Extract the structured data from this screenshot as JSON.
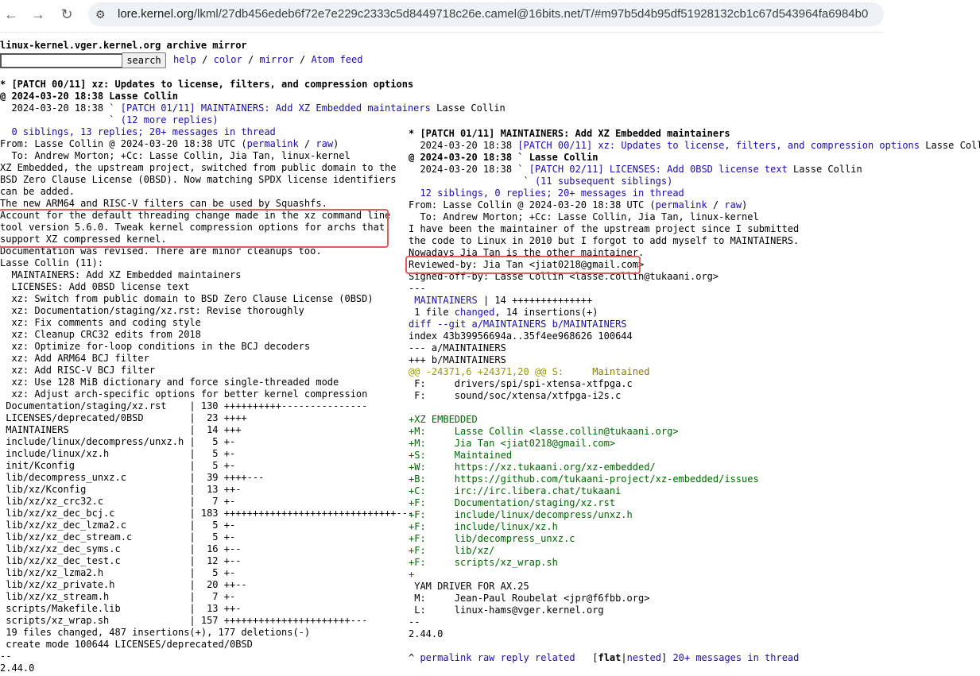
{
  "browser": {
    "url_host": "lore.kernel.org",
    "url_path": "/lkml/27db456edeb6f72e7e229c2333c5d8449718c26e.camel@16bits.net/T/#m97b5d4b95df51928132cb1c67d543964fa6984b0"
  },
  "header": {
    "title": "linux-kernel.vger.kernel.org archive mirror",
    "search_label": "search",
    "links": [
      "help",
      "color",
      "mirror",
      "Atom feed"
    ]
  },
  "left": {
    "subject_line": "* [PATCH 00/11] xz: Updates to license, filters, and compression options",
    "date_line": "@ 2024-03-20 18:38 Lasse Collin",
    "reply_line_pre": "  2024-03-20 18:38 ` ",
    "reply_link": "[PATCH 01/11] MAINTAINERS: Add XZ Embedded maintainers",
    "reply_author": " Lasse Collin",
    "more_replies_pre": "                   ` ",
    "more_replies": "(12 more replies)",
    "siblings": "  0 siblings, 13 replies; 20+ messages in thread",
    "from_pre": "From: Lasse Collin @ 2024-03-20 18:38 UTC (",
    "permalink": "permalink",
    "raw": "raw",
    "to_line": "  To: Andrew Morton; +Cc: Lasse Collin, Jia Tan, linux-kernel",
    "body_lines": [
      "XZ Embedded, the upstream project, switched from public domain to the",
      "BSD Zero Clause License (0BSD). Now matching SPDX license identifiers",
      "can be added.",
      "The new ARM64 and RISC-V filters can be used by Squashfs."
    ],
    "highlight_lines": [
      "Account for the default threading change made in the xz command line",
      "tool version 5.6.0. Tweak kernel compression options for archs that",
      "support XZ compressed kernel."
    ],
    "after_lines": [
      "Documentation was revised. There are minor cleanups too.",
      "Lasse Collin (11):",
      "  MAINTAINERS: Add XZ Embedded maintainers",
      "  LICENSES: Add 0BSD license text",
      "  xz: Switch from public domain to BSD Zero Clause License (0BSD)",
      "  xz: Documentation/staging/xz.rst: Revise thoroughly",
      "  xz: Fix comments and coding style",
      "  xz: Cleanup CRC32 edits from 2018",
      "  xz: Optimize for-loop conditions in the BCJ decoders",
      "  xz: Add ARM64 BCJ filter",
      "  xz: Add RISC-V BCJ filter",
      "  xz: Use 128 MiB dictionary and force single-threaded mode",
      "  xz: Adjust arch-specific options for better kernel compression"
    ],
    "diffstat": [
      " Documentation/staging/xz.rst    | 130 ++++++++++---------------",
      " LICENSES/deprecated/0BSD        |  23 ++++",
      " MAINTAINERS                     |  14 +++",
      " include/linux/decompress/unxz.h |   5 +-",
      " include/linux/xz.h              |   5 +-",
      " init/Kconfig                    |   5 +-",
      " lib/decompress_unxz.c           |  39 ++++---",
      " lib/xz/Kconfig                  |  13 ++-",
      " lib/xz/xz_crc32.c               |   7 +-",
      " lib/xz/xz_dec_bcj.c             | 183 ++++++++++++++++++++++++++++++---",
      " lib/xz/xz_dec_lzma2.c           |   5 +-",
      " lib/xz/xz_dec_stream.c          |   5 +-",
      " lib/xz/xz_dec_syms.c            |  16 +--",
      " lib/xz/xz_dec_test.c            |  12 +--",
      " lib/xz/xz_lzma2.h               |   5 +-",
      " lib/xz/xz_private.h             |  20 ++--",
      " lib/xz/xz_stream.h              |   7 +-",
      " scripts/Makefile.lib            |  13 ++-",
      " scripts/xz_wrap.sh              | 157 ++++++++++++++++++++++---",
      " 19 files changed, 487 insertions(+), 177 deletions(-)",
      " create mode 100644 LICENSES/deprecated/0BSD",
      "--",
      "2.44.0"
    ]
  },
  "right": {
    "subject_line": "* [PATCH 01/11] MAINTAINERS: Add XZ Embedded maintainers",
    "parent_pre": "  2024-03-20 18:38 ",
    "parent_link": "[PATCH 00/11] xz: Updates to license, filters, and compression options",
    "parent_author": " Lasse Collin",
    "date_line": "@ 2024-03-20 18:38 ` Lasse Collin",
    "child_pre": "  2024-03-20 18:38 ` ",
    "child_link": "[PATCH 02/11] LICENSES: Add 0BSD license text",
    "child_author": " Lasse Collin",
    "subsequent_pre": "                    ` ",
    "subsequent": "(11 subsequent siblings)",
    "siblings": "  12 siblings, 0 replies; 20+ messages in thread",
    "from_pre": "From: Lasse Collin @ 2024-03-20 18:38 UTC (",
    "permalink": "permalink",
    "raw": "raw",
    "to_line": "  To: Andrew Morton; +Cc: Lasse Collin, Jia Tan, linux-kernel",
    "body_lines": [
      "I have been the maintainer of the upstream project since I submitted",
      "the code to Linux in 2010 but I forgot to add myself to MAINTAINERS.",
      "Nowadays Jia Tan is the other maintainer."
    ],
    "reviewed_by": "Reviewed-by: Jia Tan <jiat0218@gmail.com>",
    "signed_off": "Signed-off-by: Lasse Collin <lasse.collin@tukaani.org>",
    "sep": "---",
    "stat_file": "MAINTAINERS",
    "stat_rest": " | 14 ++++++++++++++",
    "files_changed_pre": " 1 file ",
    "files_changed_link": "changed",
    "files_changed_post": ", 14 insertions(+)",
    "diff_git": "diff --git a/MAINTAINERS b/MAINTAINERS",
    "index_line": "index 43b39956694a..35f4ee968626 100644",
    "minus_file": "--- a/MAINTAINERS",
    "plus_file": "+++ b/MAINTAINERS",
    "hunk": "@@ -24371,6 +24371,20 @@ S:",
    "hunk_tail": "     Maintained",
    "ctx_lines": [
      " F:     drivers/spi/spi-xtensa-xtfpga.c",
      " F:     sound/soc/xtensa/xtfpga-i2s.c",
      ""
    ],
    "added_lines": [
      "+XZ EMBEDDED",
      "+M:     Lasse Collin <lasse.collin@tukaani.org>",
      "+M:     Jia Tan <jiat0218@gmail.com>",
      "+S:     Maintained",
      "+W:     https://xz.tukaani.org/xz-embedded/",
      "+B:     https://github.com/tukaani-project/xz-embedded/issues",
      "+C:     irc://irc.libera.chat/tukaani",
      "+F:     Documentation/staging/xz.rst",
      "+F:     include/linux/decompress/unxz.h",
      "+F:     include/linux/xz.h",
      "+F:     lib/decompress_unxz.c",
      "+F:     lib/xz/",
      "+F:     scripts/xz_wrap.sh",
      "+"
    ],
    "tail_lines": [
      " YAM DRIVER FOR AX.25",
      " M:     Jean-Paul Roubelat <jpr@f6fbb.org>",
      " L:     linux-hams@vger.kernel.org",
      "--",
      "2.44.0"
    ],
    "footer": {
      "caret": "^ ",
      "permalink": "permalink",
      "raw": "raw",
      "reply": "reply",
      "related": "related",
      "flat": "flat",
      "nested": "nested",
      "messages": "20+ messages in thread"
    }
  },
  "colors": {
    "link": "#1a0dab",
    "highlight_box": "#e35d5d",
    "diff_add": "#006400",
    "diff_hunk": "#999900"
  }
}
